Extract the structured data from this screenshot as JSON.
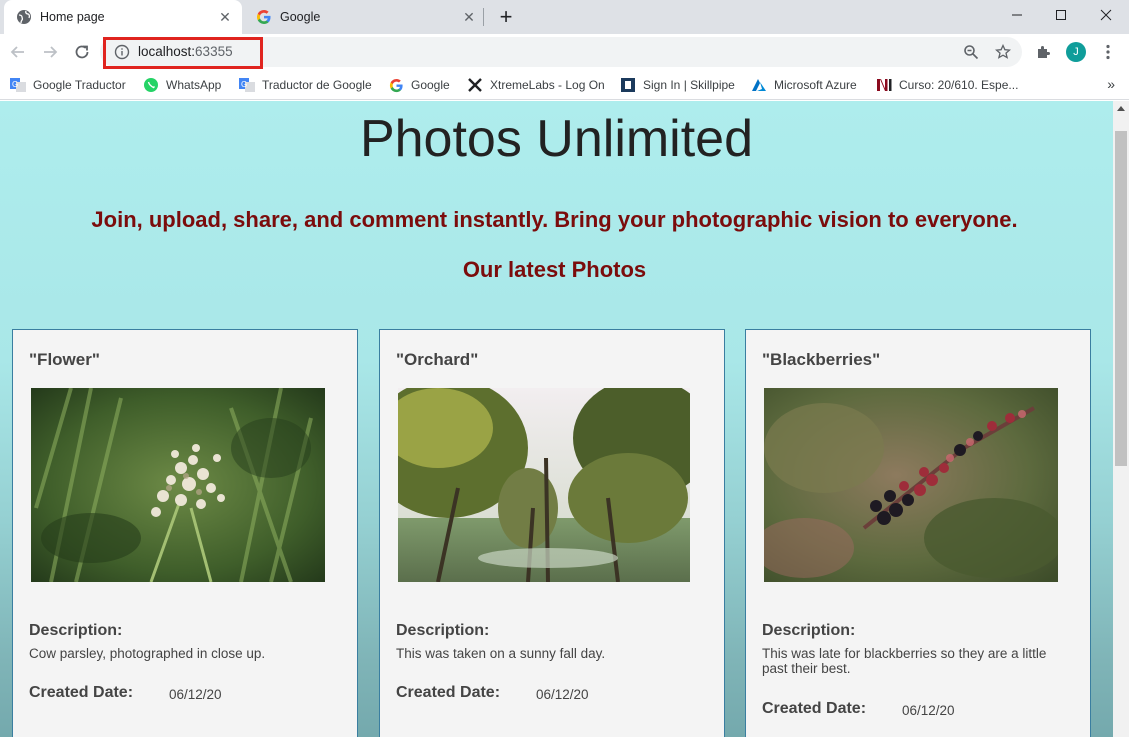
{
  "browser": {
    "tabs": [
      {
        "title": "Home page",
        "icon": "globe-icon",
        "active": true
      },
      {
        "title": "Google",
        "icon": "google-icon",
        "active": false
      }
    ],
    "url_host": "localhost:",
    "url_port": "63355",
    "profile_initial": "J",
    "highlight_color": "#e0241f",
    "bookmarks": [
      {
        "label": "Google Traductor",
        "icon": "google-translate-icon"
      },
      {
        "label": "WhatsApp",
        "icon": "whatsapp-icon"
      },
      {
        "label": "Traductor de Google",
        "icon": "google-translate-icon"
      },
      {
        "label": "Google",
        "icon": "google-icon"
      },
      {
        "label": "XtremeLabs - Log On",
        "icon": "xtremelabs-icon"
      },
      {
        "label": "Sign In | Skillpipe",
        "icon": "skillpipe-icon"
      },
      {
        "label": "Microsoft Azure",
        "icon": "azure-icon"
      },
      {
        "label": "Curso: 20/610. Espe...",
        "icon": "ni-icon"
      }
    ],
    "more_bookmarks": "»"
  },
  "page": {
    "title": "Photos Unlimited",
    "tagline": "Join, upload, share, and comment instantly. Bring your photographic vision to everyone.",
    "section_title": "Our latest Photos",
    "title_color": "#222222",
    "accent_color": "#7b0c0c",
    "description_label": "Description:",
    "created_label": "Created Date:",
    "photos": [
      {
        "title": "\"Flower\"",
        "description": "Cow parsley, photographed in close up.",
        "created": "06/12/20"
      },
      {
        "title": "\"Orchard\"",
        "description": "This was taken on a sunny fall day.",
        "created": "06/12/20"
      },
      {
        "title": "\"Blackberries\"",
        "description": "This was late for blackberries so they are a little past their best.",
        "created": "06/12/20"
      }
    ]
  }
}
